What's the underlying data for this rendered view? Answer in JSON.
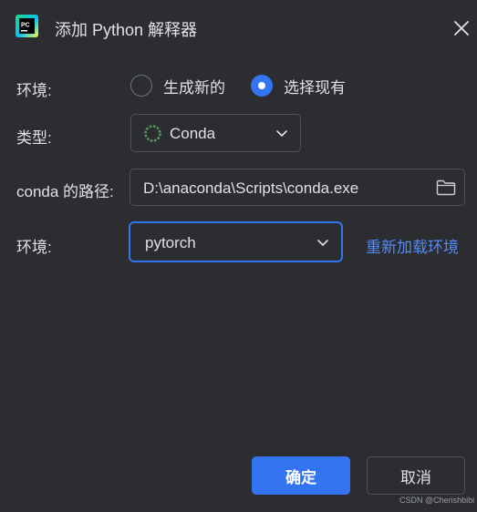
{
  "window": {
    "title": "添加 Python 解释器",
    "app_icon": "pycharm-logo-icon",
    "close_icon": "close-icon"
  },
  "environment_mode": {
    "label": "环境:",
    "options": [
      {
        "label": "生成新的",
        "checked": false
      },
      {
        "label": "选择现有",
        "checked": true
      }
    ]
  },
  "type": {
    "label": "类型:",
    "value": "Conda",
    "icon": "conda-spinner-icon"
  },
  "conda_path": {
    "label": "conda 的路径:",
    "value": "D:\\anaconda\\Scripts\\conda.exe",
    "browse_icon": "folder-icon"
  },
  "environment": {
    "label": "环境:",
    "value": "pytorch",
    "reload_link": "重新加载环境"
  },
  "buttons": {
    "ok": "确定",
    "cancel": "取消"
  },
  "watermark": "CSDN @Cherishbibi",
  "colors": {
    "background": "#2b2d30",
    "accent": "#3574f0",
    "link": "#548af7",
    "border": "#4e5157",
    "text": "#dfe1e5",
    "conda_green": "#57965c"
  }
}
